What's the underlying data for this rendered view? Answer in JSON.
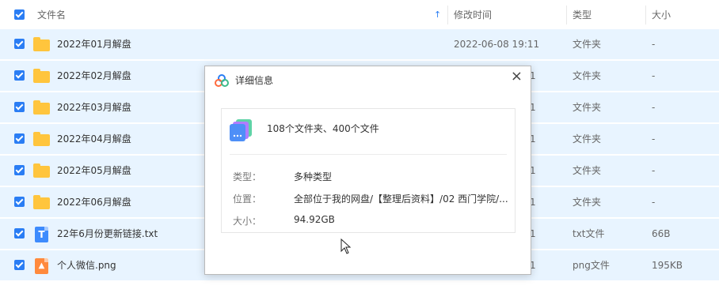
{
  "header": {
    "name_col": "文件名",
    "sort_icon": "sort-ascending-arrow",
    "time_col": "修改时间",
    "type_col": "类型",
    "size_col": "大小"
  },
  "rows": [
    {
      "name": "2022年01月解盘",
      "time": "2022-06-08 19:11",
      "type": "文件夹",
      "size": "-",
      "icon": "folder-icon"
    },
    {
      "name": "2022年02月解盘",
      "time": "1",
      "type": "文件夹",
      "size": "-",
      "icon": "folder-icon"
    },
    {
      "name": "2022年03月解盘",
      "time": "1",
      "type": "文件夹",
      "size": "-",
      "icon": "folder-icon"
    },
    {
      "name": "2022年04月解盘",
      "time": "1",
      "type": "文件夹",
      "size": "-",
      "icon": "folder-icon"
    },
    {
      "name": "2022年05月解盘",
      "time": "1",
      "type": "文件夹",
      "size": "-",
      "icon": "folder-icon"
    },
    {
      "name": "2022年06月解盘",
      "time": "1",
      "type": "文件夹",
      "size": "-",
      "icon": "folder-icon"
    },
    {
      "name": "22年6月份更新链接.txt",
      "time": "1",
      "type": "txt文件",
      "size": "66B",
      "icon": "txt-file-icon",
      "icon_letter": "T"
    },
    {
      "name": "个人微信.png",
      "time": "1",
      "type": "png文件",
      "size": "195KB",
      "icon": "png-file-icon",
      "icon_letter": "▲"
    }
  ],
  "dialog": {
    "title": "详细信息",
    "close": "×",
    "summary": "108个文件夹、400个文件",
    "type_label": "类型：",
    "type_value": "多种类型",
    "location_label": "位置：",
    "location_value": "全部位于我的网盘/【整理后资料】/02 西门学院/...",
    "size_label": "大小：",
    "size_value": "94.92GB"
  },
  "colors": {
    "accent": "#2a7df4",
    "row_selected": "#e8f4ff",
    "folder": "#ffc53d"
  }
}
